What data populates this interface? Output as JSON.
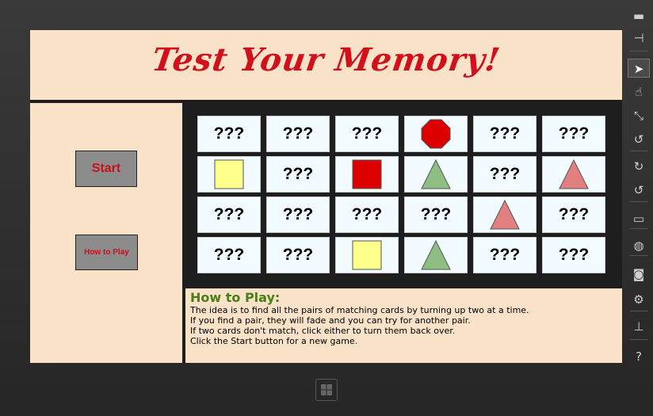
{
  "title": "Test Your Memory!",
  "buttons": {
    "start": "Start",
    "how_to_play": "How to Play"
  },
  "colors": {
    "background": "#f9e2c7",
    "title": "#d0101a",
    "button": "#8c8c8c",
    "card": "#f2fbff",
    "help_heading": "#4a7e16"
  },
  "board": {
    "rows": [
      [
        {
          "face": "???"
        },
        {
          "face": "???"
        },
        {
          "face": "???"
        },
        {
          "face": "shape",
          "shape": "octagon",
          "color": "#dd0000"
        },
        {
          "face": "???"
        },
        {
          "face": "???"
        }
      ],
      [
        {
          "face": "shape",
          "shape": "square",
          "color": "#ffff8c"
        },
        {
          "face": "???"
        },
        {
          "face": "shape",
          "shape": "square",
          "color": "#dd0000"
        },
        {
          "face": "shape",
          "shape": "triangle",
          "color": "#8fbe84"
        },
        {
          "face": "???"
        },
        {
          "face": "shape",
          "shape": "triangle",
          "color": "#e27f80"
        }
      ],
      [
        {
          "face": "???"
        },
        {
          "face": "???"
        },
        {
          "face": "???"
        },
        {
          "face": "???"
        },
        {
          "face": "shape",
          "shape": "triangle",
          "color": "#e27f80"
        },
        {
          "face": "???"
        }
      ],
      [
        {
          "face": "???"
        },
        {
          "face": "???"
        },
        {
          "face": "shape",
          "shape": "square",
          "color": "#ffff8c"
        },
        {
          "face": "shape",
          "shape": "triangle",
          "color": "#8fbe84"
        },
        {
          "face": "???"
        },
        {
          "face": "???"
        }
      ]
    ]
  },
  "how_to_play": {
    "heading": "How to Play:",
    "lines": [
      "The idea is to find all the pairs of matching cards  by turning up two at a time.",
      "If you find a pair, they will fade  and you can try for another pair.",
      "If two cards don't match, click either to turn them back over.",
      "Click the Start button for a new game."
    ]
  },
  "simulator_toolbar": [
    {
      "name": "minimize-icon",
      "glyph": "▬"
    },
    {
      "name": "pin-icon",
      "glyph": "⊣"
    },
    {
      "name": "pointer-icon",
      "glyph": "➤",
      "active": true
    },
    {
      "name": "touch-icon",
      "glyph": "☝"
    },
    {
      "name": "pinch-icon",
      "glyph": "⤡"
    },
    {
      "name": "rotate-gesture-icon",
      "glyph": "↺"
    },
    {
      "name": "rotate-clockwise-icon",
      "glyph": "↻"
    },
    {
      "name": "rotate-counterclockwise-icon",
      "glyph": "↺"
    },
    {
      "name": "resolution-icon",
      "glyph": "▭"
    },
    {
      "name": "location-icon",
      "glyph": "◍"
    },
    {
      "name": "screenshot-icon",
      "glyph": "◙"
    },
    {
      "name": "settings-icon",
      "glyph": "⚙"
    },
    {
      "name": "network-icon",
      "glyph": "⊥"
    },
    {
      "name": "help-icon",
      "glyph": "?"
    }
  ]
}
